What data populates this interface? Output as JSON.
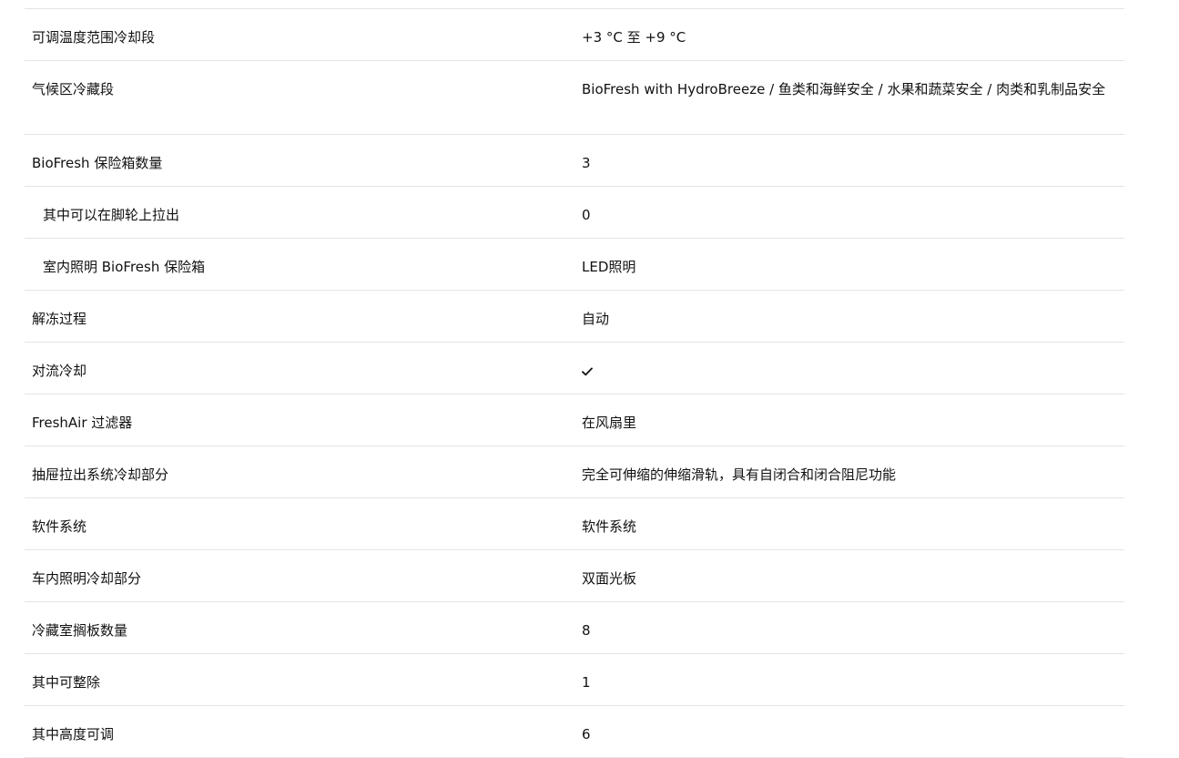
{
  "specs": [
    {
      "label": "可调温度范围冷却段",
      "value": "+3 °C 至 +9 °C"
    },
    {
      "label": "气候区冷藏段",
      "value": "BioFresh with HydroBreeze / 鱼类和海鲜安全 / 水果和蔬菜安全 / 肉类和乳制品安全"
    },
    {
      "label": "BioFresh 保险箱数量",
      "value": "3"
    },
    {
      "label": "其中可以在脚轮上拉出",
      "value": "0"
    },
    {
      "label": "室内照明 BioFresh 保险箱",
      "value": "LED照明"
    },
    {
      "label": "解冻过程",
      "value": "自动"
    },
    {
      "label": "对流冷却",
      "value": "",
      "icon": "checkmark-icon"
    },
    {
      "label": "FreshAir 过滤器",
      "value": "在风扇里"
    },
    {
      "label": "抽屉拉出系统冷却部分",
      "value": "完全可伸缩的伸缩滑轨，具有自闭合和闭合阻尼功能"
    },
    {
      "label": "软件系统",
      "value": "软件系统"
    },
    {
      "label": "车内照明冷却部分",
      "value": "双面光板"
    },
    {
      "label": "冷藏室搁板数量",
      "value": "8"
    },
    {
      "label": "其中可整除",
      "value": "1"
    },
    {
      "label": "其中高度可调",
      "value": "6"
    }
  ]
}
